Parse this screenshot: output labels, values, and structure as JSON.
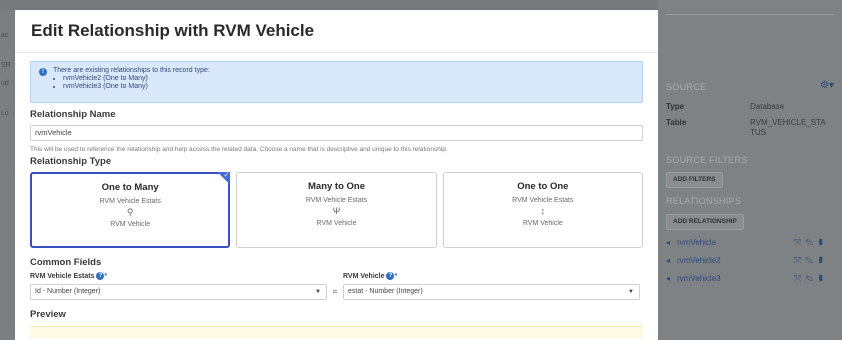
{
  "modal": {
    "title": "Edit Relationship with RVM Vehicle",
    "alert": {
      "message": "There are existing relationships to this record type:",
      "items": [
        "rvmVehicle2 (One to Many)",
        "rvmVehicle3 (One to Many)"
      ]
    },
    "relationship_name": {
      "label": "Relationship Name",
      "value": "rvmVehicle",
      "help": "This will be used to reference the relationship and help access the related data. Choose a name that is descriptive and unique to this relationship."
    },
    "relationship_type": {
      "label": "Relationship Type",
      "cards": [
        {
          "title": "One to Many",
          "top": "RVM Vehicle Estats",
          "icon": "⚲",
          "bottom": "RVM Vehicle",
          "selected": true
        },
        {
          "title": "Many to One",
          "top": "RVM Vehicle Estats",
          "icon": "Ψ",
          "bottom": "RVM Vehicle",
          "selected": false
        },
        {
          "title": "One to One",
          "top": "RVM Vehicle Estats",
          "icon": "↕",
          "bottom": "RVM Vehicle",
          "selected": false
        }
      ]
    },
    "common_fields": {
      "label": "Common Fields",
      "left_label": "RVM Vehicle Estats",
      "left_value": "Id - Number (Integer)",
      "right_label": "RVM Vehicle",
      "right_value": "estat - Number (Integer)",
      "equals": "="
    },
    "preview": {
      "label": "Preview"
    }
  },
  "right_panel": {
    "source_label": "SOURCE",
    "type_key": "Type",
    "type_value": "Database",
    "table_key": "Table",
    "table_value": "RVM_VEHICLE_STATUS",
    "source_filters_label": "SOURCE FILTERS",
    "add_filters": "ADD FILTERS",
    "relationships_label": "RELATIONSHIPS",
    "add_relationship": "ADD RELATIONSHIP",
    "relationships": [
      "rvmVehicle",
      "rvmVehicle2",
      "rvmVehicle3"
    ]
  },
  "left_strip": [
    "ac",
    "SR",
    "ud",
    "Lo"
  ],
  "colors": {
    "accent": "#3b4fc2",
    "link": "#2c4a78",
    "alert_bg": "#d9e8fb"
  }
}
